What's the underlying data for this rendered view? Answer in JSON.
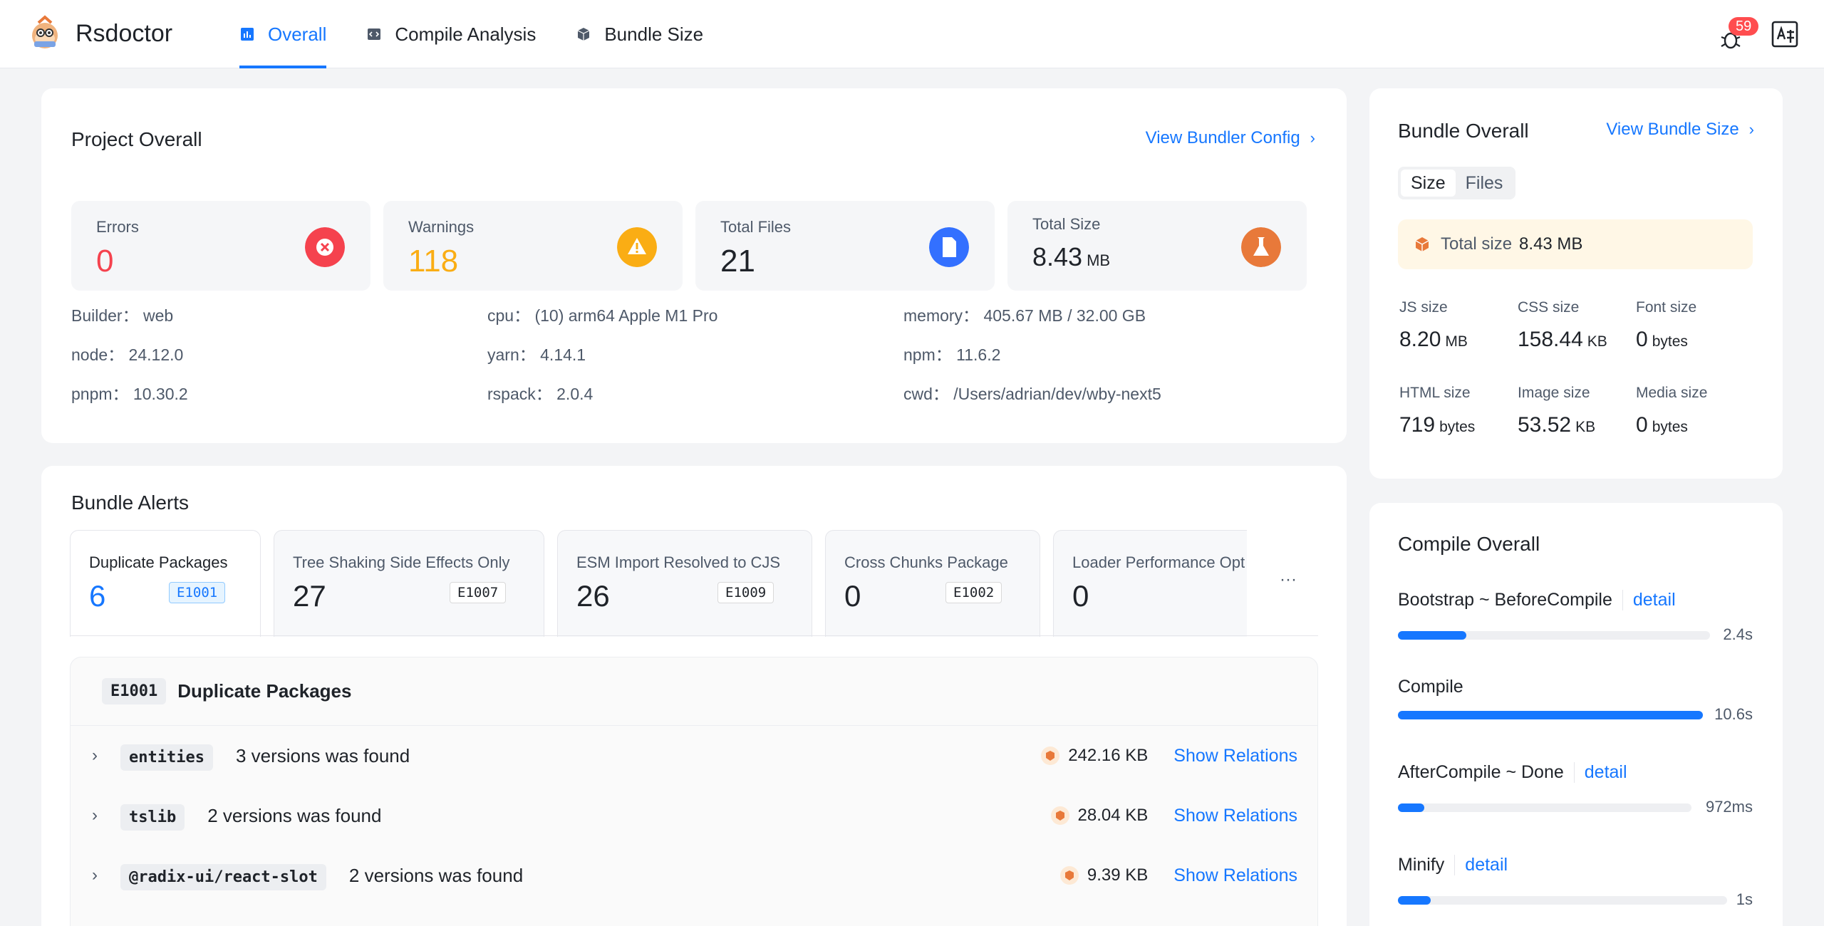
{
  "header": {
    "app_name": "Rsdoctor",
    "nav": [
      {
        "label": "Overall",
        "icon": "chart-bar-icon",
        "active": true
      },
      {
        "label": "Compile Analysis",
        "icon": "code-icon",
        "active": false
      },
      {
        "label": "Bundle Size",
        "icon": "box-icon",
        "active": false
      }
    ],
    "notification_count": "59"
  },
  "project": {
    "title": "Project Overall",
    "config_link": "View Bundler Config",
    "stats": [
      {
        "label": "Errors",
        "value": "0",
        "unit": "",
        "color": "#f5424e",
        "icon": "close-circle-icon"
      },
      {
        "label": "Warnings",
        "value": "118",
        "unit": "",
        "color": "#faad14",
        "icon": "warning-icon"
      },
      {
        "label": "Total Files",
        "value": "21",
        "unit": "",
        "color": "#1f2329",
        "icon": "file-icon"
      },
      {
        "label": "Total Size",
        "value": "8.43",
        "unit": "MB",
        "color": "#1f2329",
        "icon": "flask-icon"
      }
    ],
    "env": [
      "Builder： web",
      "cpu： (10) arm64 Apple M1 Pro",
      "memory： 405.67 MB / 32.00 GB",
      "node： 24.12.0",
      "yarn： 4.14.1",
      "npm： 11.6.2",
      "pnpm： 10.30.2",
      "rspack： 2.0.4",
      "cwd： /Users/adrian/dev/wby-next5"
    ]
  },
  "alerts": {
    "title": "Bundle Alerts",
    "tabs": [
      {
        "label": "Duplicate Packages",
        "count": "6",
        "code": "E1001"
      },
      {
        "label": "Tree Shaking Side Effects Only",
        "count": "27",
        "code": "E1007"
      },
      {
        "label": "ESM Import Resolved to CJS",
        "count": "26",
        "code": "E1009"
      },
      {
        "label": "Cross Chunks Package",
        "count": "0",
        "code": "E1002"
      },
      {
        "label": "Loader Performance Opt",
        "count": "0",
        "code": ""
      }
    ],
    "more": "···",
    "panel": {
      "code": "E1001",
      "title": "Duplicate Packages",
      "rows": [
        {
          "pkg": "entities",
          "versions": "3 versions was found",
          "size": "242.16 KB",
          "action": "Show Relations"
        },
        {
          "pkg": "tslib",
          "versions": "2 versions was found",
          "size": "28.04 KB",
          "action": "Show Relations"
        },
        {
          "pkg": "@radix-ui/react-slot",
          "versions": "2 versions was found",
          "size": "9.39 KB",
          "action": "Show Relations"
        }
      ]
    }
  },
  "bundle": {
    "title": "Bundle Overall",
    "link": "View Bundle Size",
    "segments": [
      "Size",
      "Files"
    ],
    "total_label": "Total size",
    "total_value": "8.43 MB",
    "sizes": [
      {
        "label": "JS size",
        "value": "8.20",
        "unit": "MB"
      },
      {
        "label": "CSS size",
        "value": "158.44",
        "unit": "KB"
      },
      {
        "label": "Font size",
        "value": "0",
        "unit": "bytes"
      },
      {
        "label": "HTML size",
        "value": "719",
        "unit": "bytes"
      },
      {
        "label": "Image size",
        "value": "53.52",
        "unit": "KB"
      },
      {
        "label": "Media size",
        "value": "0",
        "unit": "bytes"
      }
    ]
  },
  "compile": {
    "title": "Compile Overall",
    "steps": [
      {
        "name": "Bootstrap ~ BeforeCompile",
        "detail": "detail",
        "duration": "2.4s",
        "fraction": 0.22
      },
      {
        "name": "Compile",
        "detail": "",
        "duration": "10.6s",
        "fraction": 1.0
      },
      {
        "name": "AfterCompile ~ Done",
        "detail": "detail",
        "duration": "972ms",
        "fraction": 0.09
      },
      {
        "name": "Minify",
        "detail": "detail",
        "duration": "1s",
        "fraction": 0.1
      }
    ]
  }
}
